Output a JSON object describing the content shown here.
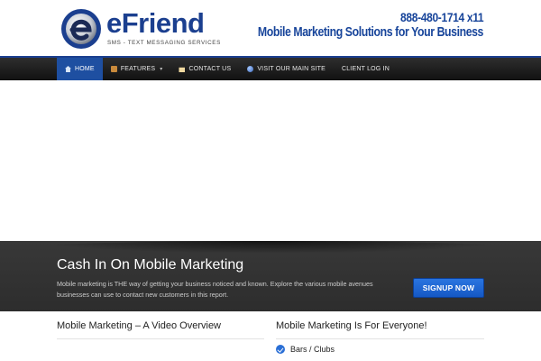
{
  "header": {
    "logo_word": "eFriend",
    "logo_tagline": "SMS - TEXT MESSAGING SERVICES",
    "phone": "888-480-1714 x11",
    "tagline": "Mobile Marketing Solutions for Your Business"
  },
  "nav": {
    "items": [
      {
        "label": "HOME",
        "icon": "home-icon",
        "active": true
      },
      {
        "label": "FEATURES",
        "icon": "features-icon",
        "has_dropdown": true
      },
      {
        "label": "CONTACT US",
        "icon": "mail-icon"
      },
      {
        "label": "VISIT OUR MAIN SITE",
        "icon": "globe-icon"
      },
      {
        "label": "CLIENT LOG IN"
      }
    ]
  },
  "callout": {
    "title": "Cash In On Mobile Marketing",
    "text": "Mobile marketing is THE way of getting your business noticed and known. Explore the various mobile avenues businesses can use to contact new customers in this report.",
    "button_label": "SIGNUP NOW"
  },
  "content": {
    "left_title": "Mobile Marketing – A Video Overview",
    "right_title": "Mobile Marketing Is For Everyone!",
    "right_list": [
      "Bars / Clubs"
    ]
  },
  "colors": {
    "brand_blue": "#1b3f8f",
    "nav_active": "#1e4fa1",
    "button_blue": "#1558c4",
    "band_dark": "#333333"
  }
}
